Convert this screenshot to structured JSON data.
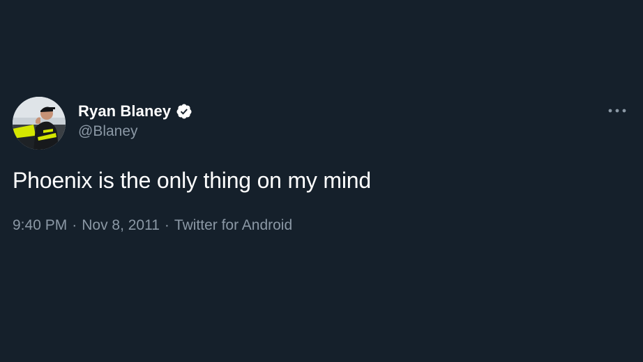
{
  "tweet": {
    "author": {
      "display_name": "Ryan Blaney",
      "handle": "@Blaney",
      "verified": true,
      "avatar_icon": "profile-photo"
    },
    "text": "Phoenix is the only thing on my mind",
    "meta": {
      "time": "9:40 PM",
      "separator": "·",
      "date": "Nov 8, 2011",
      "source": "Twitter for Android"
    },
    "more_icon": "ellipsis-icon"
  },
  "colors": {
    "background": "#15202b",
    "primary_text": "#ffffff",
    "secondary_text": "#8b98a5",
    "avatar_accent": "#d4e600"
  }
}
